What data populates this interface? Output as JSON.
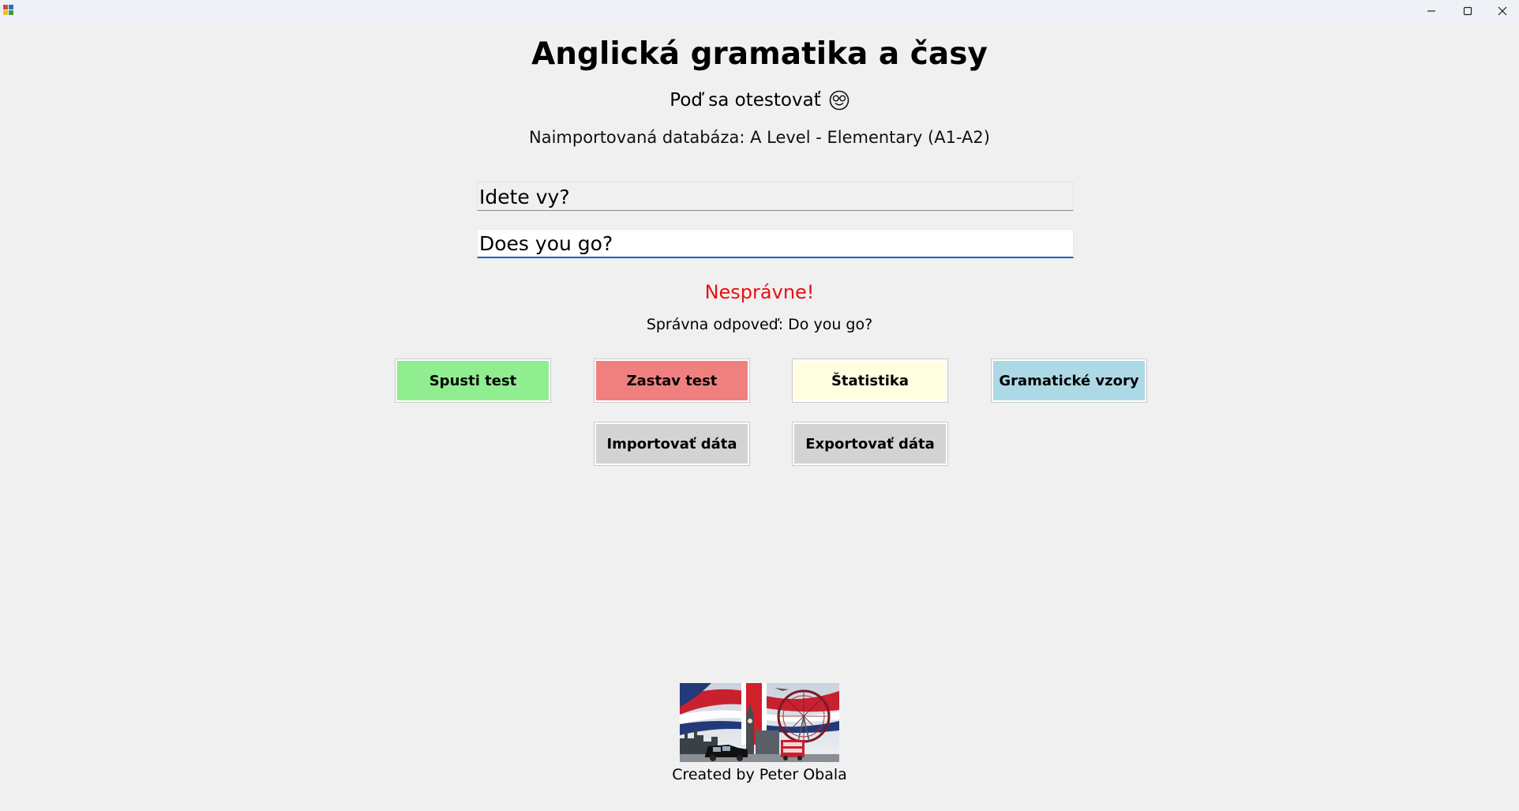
{
  "window": {
    "minimize_symbol": "—",
    "maximize_symbol": "☐",
    "close_symbol": "✕"
  },
  "header": {
    "title": "Anglická gramatika a časy",
    "subtitle": "Poď sa otestovať",
    "database_line": "Naimportovaná databáza: A Level - Elementary (A1-A2)"
  },
  "quiz": {
    "question": "Idete vy?",
    "answer_value": "Does you go?",
    "verdict": "Nesprávne!",
    "correct_answer_line": "Správna odpoveď: Do you go?"
  },
  "buttons": {
    "start": "Spusti test",
    "stop": "Zastav test",
    "stats": "Štatistika",
    "grammar": "Gramatické vzory",
    "import": "Importovať dáta",
    "export": "Exportovať dáta"
  },
  "colors": {
    "start": "#90ee90",
    "stop": "#f08080",
    "stats": "#ffffe0",
    "grammar": "#add8e6",
    "data_buttons": "#d3d3d3",
    "verdict": "#e81010",
    "focus_underline": "#0067c0"
  },
  "icons": {
    "subtitle_icon": "smiling-face-with-glasses-icon",
    "logo": "london-union-jack-illustration"
  },
  "footer": {
    "credit": "Created by Peter Obala"
  }
}
